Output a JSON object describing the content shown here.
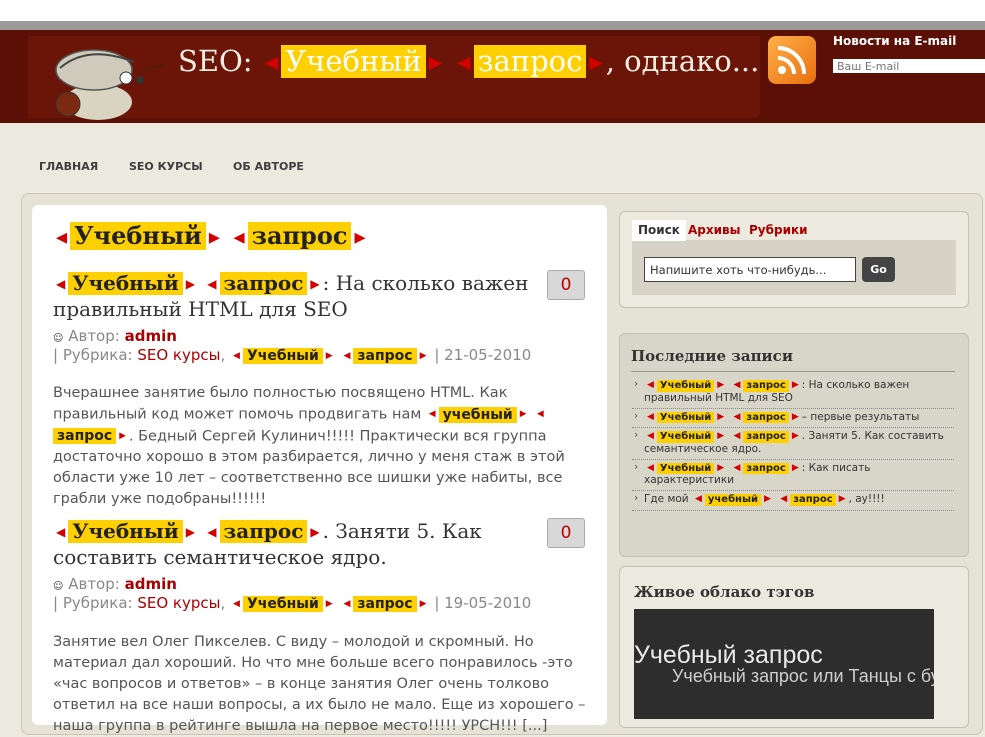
{
  "header": {
    "title_prefix": "SEO:",
    "title_tag1": "Учебный",
    "title_tag2": "запрос",
    "title_suffix": ", однако...",
    "email_title": "Новости на E-mail",
    "email_placeholder": "Ваш E-mail"
  },
  "nav": {
    "items": [
      "ГЛАВНАЯ",
      "SEO КУРСЫ",
      "ОБ АВТОРЕ"
    ]
  },
  "page_heading": {
    "tag1": "Учебный",
    "tag2": "запрос"
  },
  "labels": {
    "author": "Автор:",
    "category": "| Рубрика:"
  },
  "posts": [
    {
      "tag1": "Учебный",
      "tag2": "запрос",
      "title_rest": ": На сколько важен правильный HTML для SEO",
      "comments": "0",
      "author": "admin",
      "category": "SEO курсы",
      "date": "| 21-05-2010",
      "excerpt_a": "Вчерашнее занятие было полностью посвящено HTML. Как  правильный код может помочь продвигать нам",
      "excerpt_tag1": "учебный",
      "excerpt_tag2": "запрос",
      "excerpt_b": ". Бедный Сергей Кулинич!!!!!  Практически вся группа достаточно хорошо в этом разбирается, лично у меня  стаж в этой области уже 10 лет – соответственно все шишки уже набиты, все грабли уже подобраны!!!!!!"
    },
    {
      "tag1": "Учебный",
      "tag2": "запрос",
      "title_rest": ". Заняти 5. Как составить семантическое ядро.",
      "comments": "0",
      "author": "admin",
      "category": "SEO курсы",
      "date": "| 19-05-2010",
      "excerpt": "Занятие вел Олег Пикселев. С виду – молодой и скромный. Но материал дал хороший. Но что мне больше всего понравилось -это «час вопросов и ответов» – в конце занятия Олег очень толково ответил на все наши вопросы, а их было не мало. Еще из хорошего – наша группа в рейтинге вышла на первое место!!!!! УРСН!!! [...]"
    }
  ],
  "sidebar": {
    "tabs": [
      "Поиск",
      "Архивы",
      "Рубрики"
    ],
    "search_placeholder": "Напишите хоть что-нибудь...",
    "search_button": "Go",
    "recent_title": "Последние записи",
    "recent": [
      {
        "pre": "",
        "tag1": "Учебный",
        "tag2": "запрос",
        "rest": ": На сколько важен правильный HTML для SEO"
      },
      {
        "pre": "",
        "tag1": "Учебный",
        "tag2": "запрос",
        "rest": "– первые результаты"
      },
      {
        "pre": "",
        "tag1": "Учебный",
        "tag2": "запрос",
        "rest": ". Заняти 5. Как составить семантическое ядро."
      },
      {
        "pre": "",
        "tag1": "Учебный",
        "tag2": "запрос",
        "rest": ": Как писать характеристики"
      },
      {
        "pre": "Где мой",
        "tag1": "учебный",
        "tag2": "запрос",
        "rest": ", ау!!!!"
      }
    ],
    "cloud_title": "Живое облако тэгов",
    "cloud_big": "Учебный запрос",
    "cloud_mid": "Учебный запрос или Танцы с бубном"
  },
  "colors": {
    "header_bg": "#5c0f04",
    "tag_bg": "#ffd000",
    "accent_red": "#a80000",
    "page_bg": "#ece9de"
  }
}
